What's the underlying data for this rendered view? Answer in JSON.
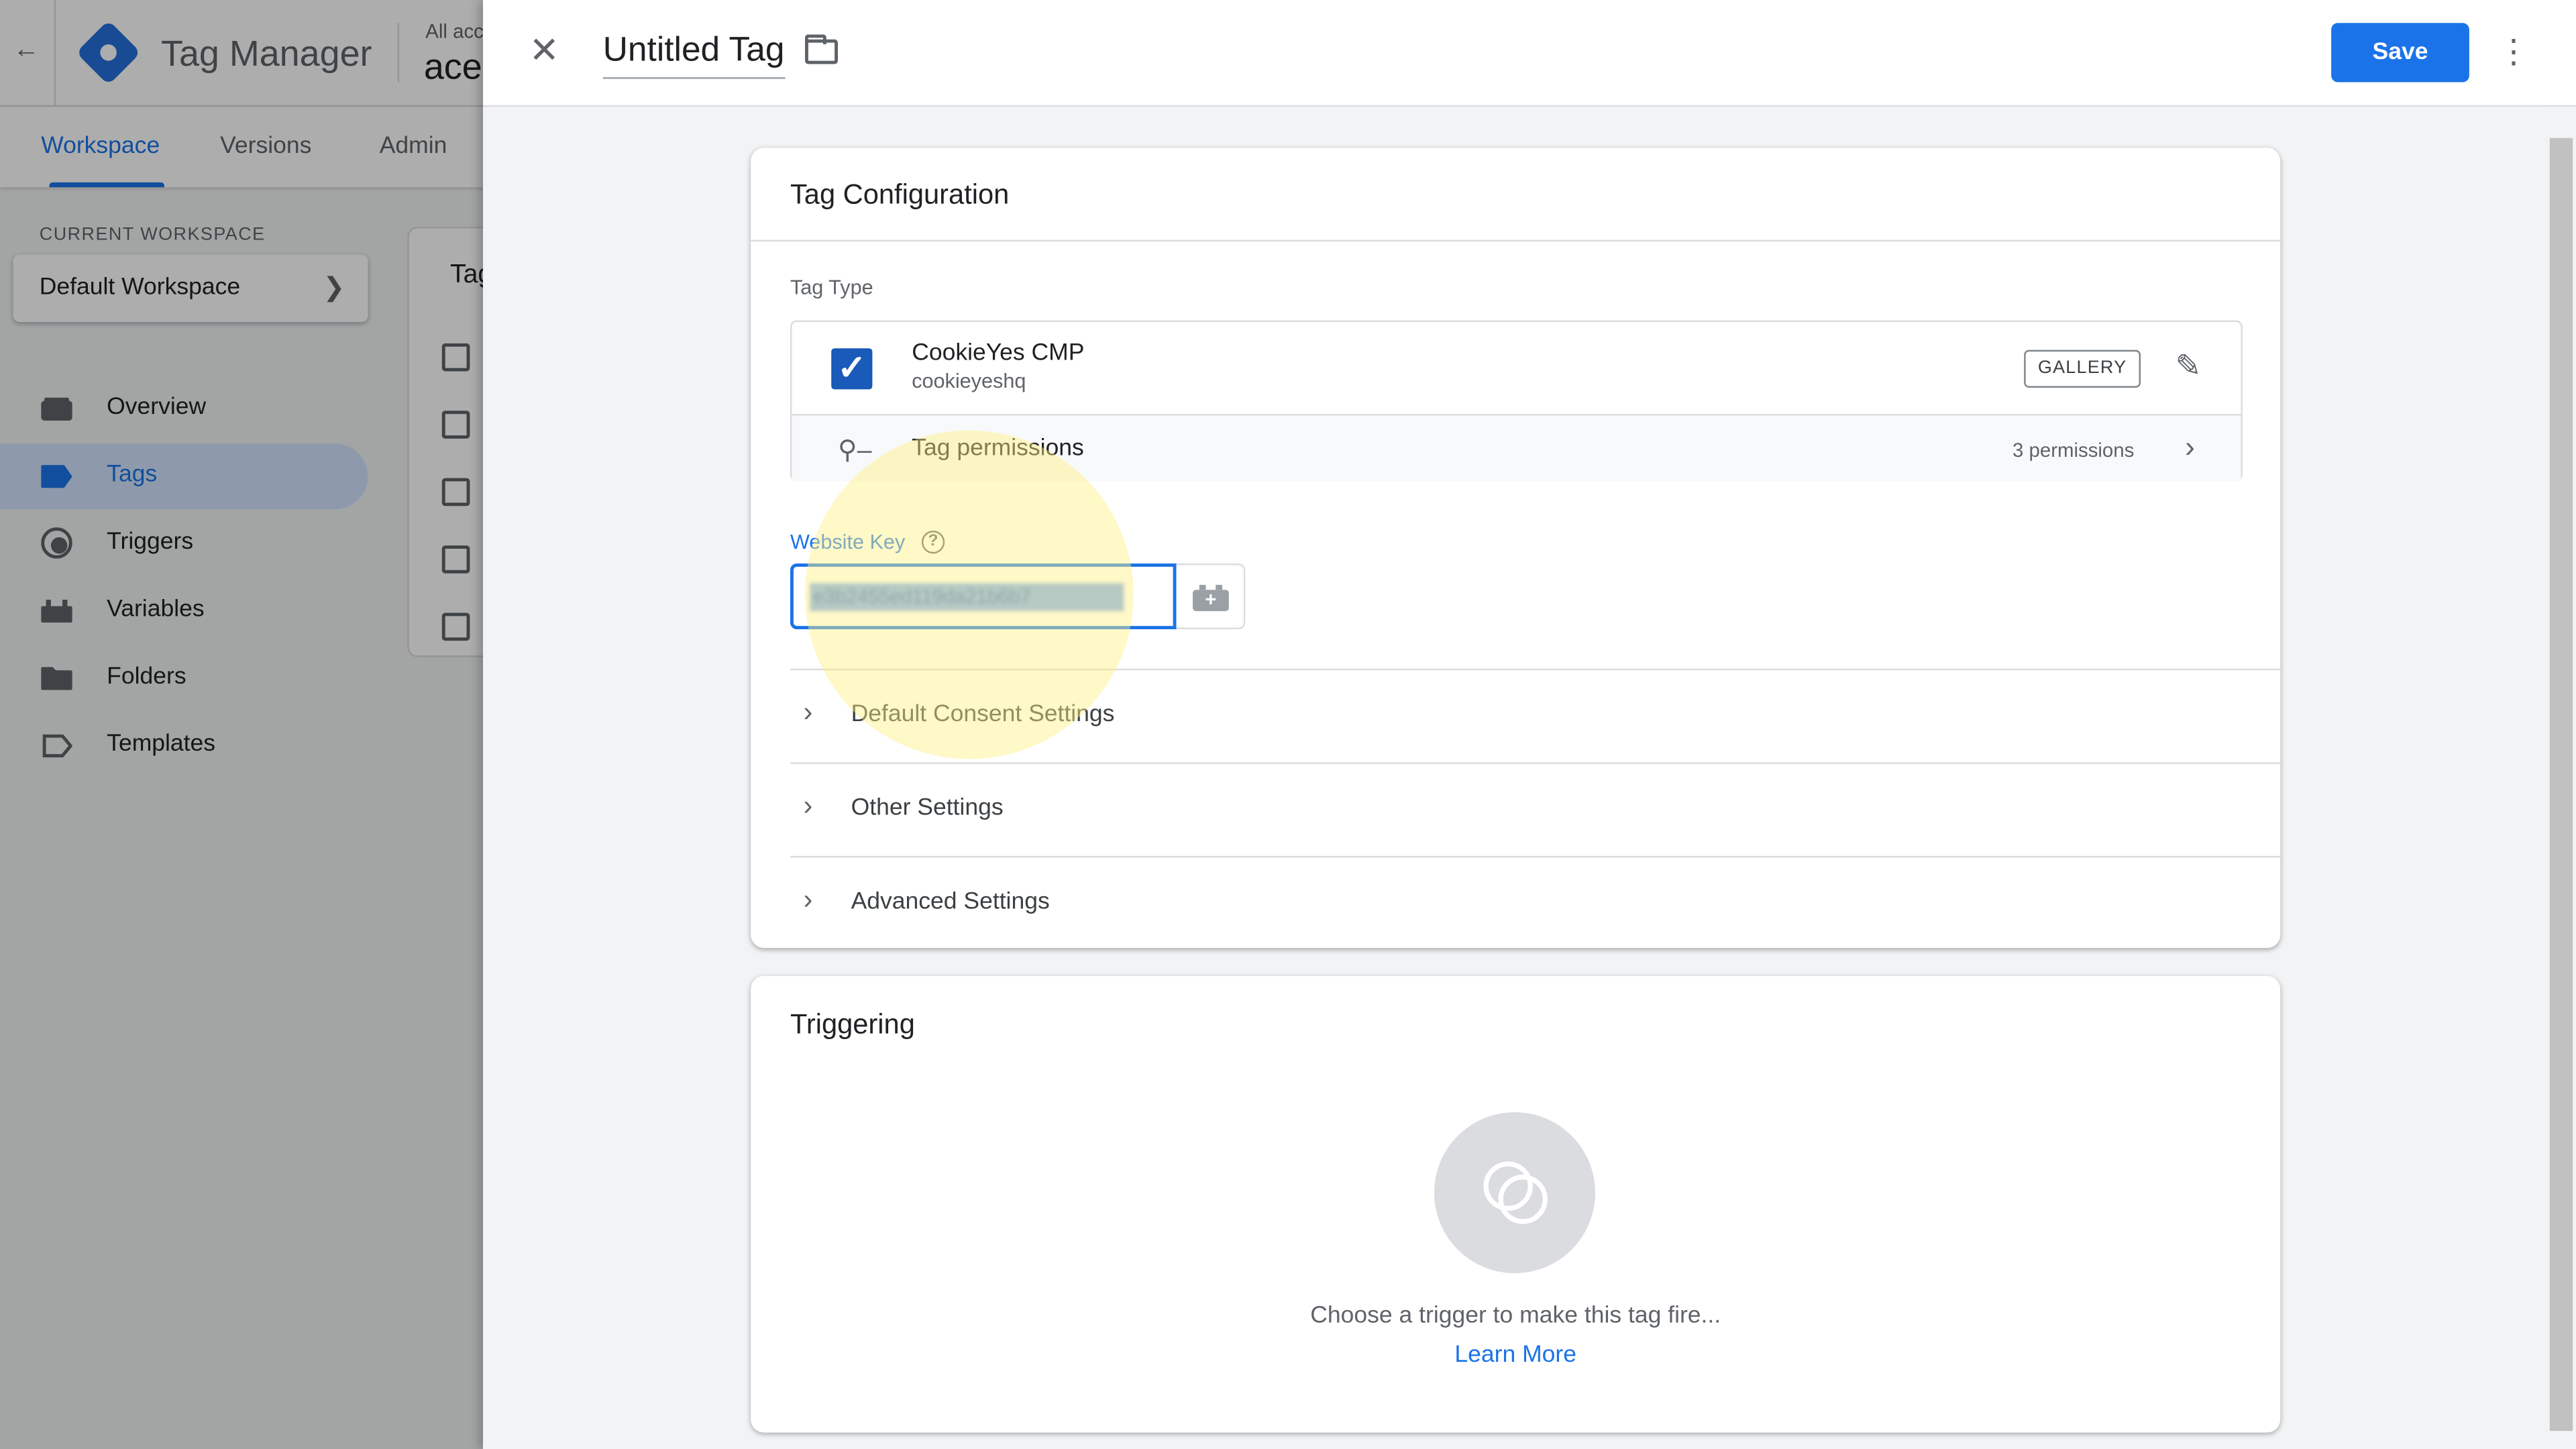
{
  "app": {
    "title": "Tag Manager",
    "account_line": "All accounts",
    "container_name": "ace"
  },
  "header_tabs": [
    {
      "label": "Workspace",
      "active": true
    },
    {
      "label": "Versions",
      "active": false
    },
    {
      "label": "Admin",
      "active": false
    }
  ],
  "workspace": {
    "section_label": "CURRENT WORKSPACE",
    "name": "Default Workspace"
  },
  "sidebar": {
    "items": [
      {
        "label": "Overview",
        "icon": "overview-icon",
        "active": false
      },
      {
        "label": "Tags",
        "icon": "tag-icon",
        "active": true
      },
      {
        "label": "Triggers",
        "icon": "trigger-icon",
        "active": false
      },
      {
        "label": "Variables",
        "icon": "variables-icon",
        "active": false
      },
      {
        "label": "Folders",
        "icon": "folder-icon",
        "active": false
      },
      {
        "label": "Templates",
        "icon": "template-icon",
        "active": false
      }
    ]
  },
  "tag_list": {
    "heading": "Tag"
  },
  "editor": {
    "title": "Untitled Tag",
    "save_label": "Save"
  },
  "tag_config": {
    "title": "Tag Configuration",
    "tag_type_label": "Tag Type",
    "tag_name": "CookieYes CMP",
    "tag_author": "cookieyeshq",
    "gallery_label": "GALLERY",
    "permissions_label": "Tag permissions",
    "permissions_count": "3 permissions",
    "website_key_label": "Website Key",
    "website_key_value": "e3b2455ed119da21b6b7",
    "sections": [
      {
        "label": "Default Consent Settings"
      },
      {
        "label": "Other Settings"
      },
      {
        "label": "Advanced Settings"
      }
    ]
  },
  "triggering": {
    "title": "Triggering",
    "empty_text": "Choose a trigger to make this tag fire...",
    "learn_more": "Learn More"
  },
  "colors": {
    "primary": "#1a73e8",
    "active_nav_bg": "#d2e3fc",
    "tag_icon": "#1a5ab8",
    "highlight": "#ffef82"
  }
}
